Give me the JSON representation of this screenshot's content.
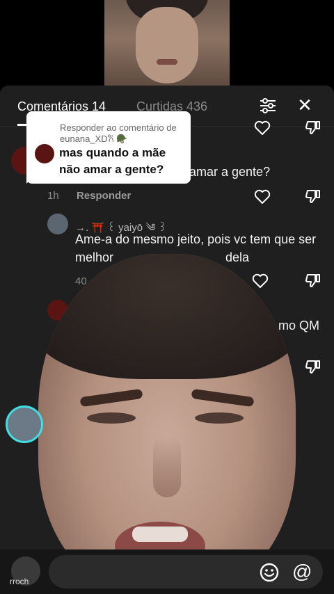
{
  "sheet": {
    "tab_comments": "Comentários 14",
    "tab_likes": "Curtidas 436"
  },
  "tooltip": {
    "reply_to": "Responder ao comentário de eunana_XD𐙚 🪖",
    "message": "mas quando a mãe não amar a gente?"
  },
  "comments": [
    {
      "text_fragment": "amar a gente?",
      "time": "1h",
      "reply_label": "Responder"
    },
    {
      "username": "→. ⛩️ ꒰ yaiyō ༄ ꒱",
      "text": "Ame-a do mesmo jeito, pois vc tem que ser melhor",
      "text_tail": "dela",
      "time": "40"
    },
    {
      "text_fragment": "mo QM"
    }
  ],
  "bottom": {
    "username_fragment": "rroch"
  },
  "icons": {
    "filter": "filter-icon",
    "close": "close-icon",
    "heart": "heart-icon",
    "dislike": "dislike-icon",
    "emoji": "emoji-icon",
    "mention": "at-icon"
  },
  "colors": {
    "sheet_bg": "#1f1f1f",
    "accent_ring": "#3ee0e5"
  }
}
